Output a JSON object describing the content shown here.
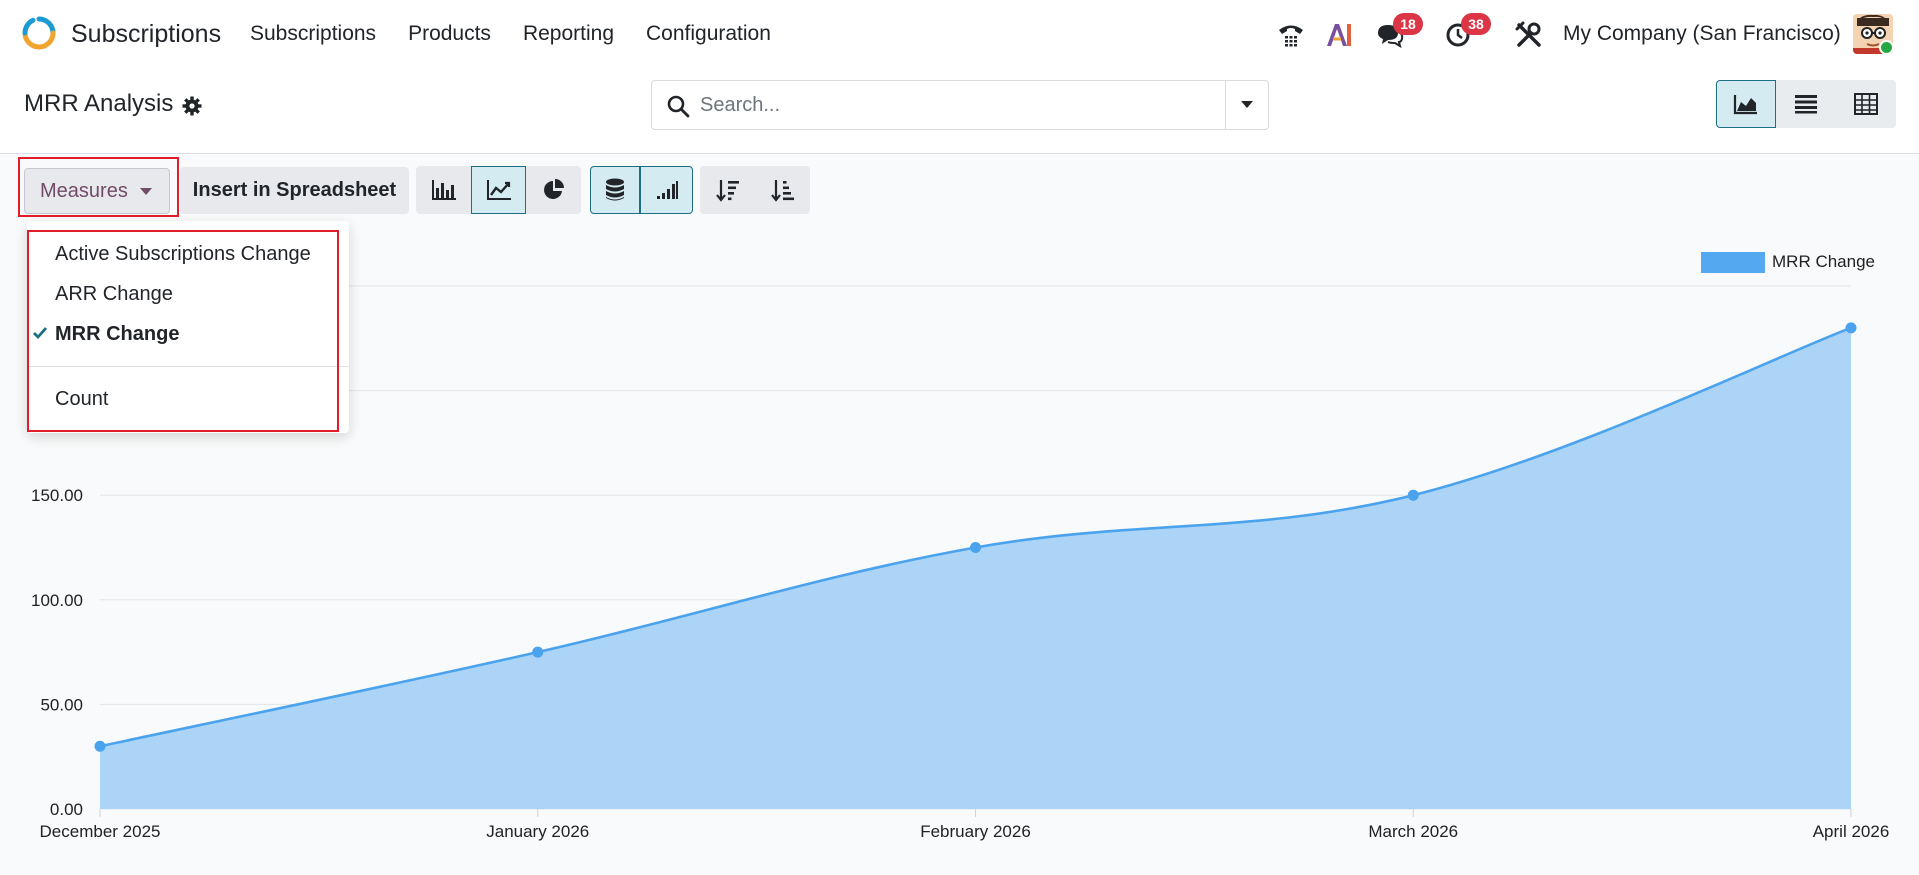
{
  "navbar": {
    "app_name": "Subscriptions",
    "menu": [
      "Subscriptions",
      "Products",
      "Reporting",
      "Configuration"
    ],
    "messages_badge": "18",
    "activities_badge": "38",
    "company": "My Company (San Francisco)",
    "icons": [
      "phone-icon",
      "ai-icon",
      "chat-icon",
      "clock-icon",
      "tools-icon"
    ]
  },
  "control_panel": {
    "title": "MRR Analysis",
    "search_placeholder": "Search...",
    "views": [
      "graph",
      "list",
      "pivot"
    ],
    "active_view": "graph"
  },
  "toolbar": {
    "measures_label": "Measures",
    "insert_label": "Insert in Spreadsheet"
  },
  "measures_dropdown": {
    "items": [
      {
        "label": "Active Subscriptions Change",
        "selected": false
      },
      {
        "label": "ARR Change",
        "selected": false
      },
      {
        "label": "MRR Change",
        "selected": true
      },
      {
        "label": "Count",
        "selected": false
      }
    ]
  },
  "colors": {
    "accent": "#1f6f82",
    "brand": "#714b67",
    "series_line": "#4aa3ec",
    "series_fill": "#a8d2f6",
    "badge": "#dc3545",
    "highlight_box": "#e11d2a"
  },
  "chart_data": {
    "type": "area",
    "categories": [
      "December 2025",
      "January 2026",
      "February 2026",
      "March 2026",
      "April 2026"
    ],
    "series": [
      {
        "name": "MRR Change",
        "values": [
          30,
          75,
          125,
          150,
          230
        ]
      }
    ],
    "y_ticks": [
      "0.00",
      "50.00",
      "100.00",
      "150.00"
    ],
    "ylim": [
      0,
      250
    ],
    "legend_position": "top-right",
    "grid": true
  }
}
